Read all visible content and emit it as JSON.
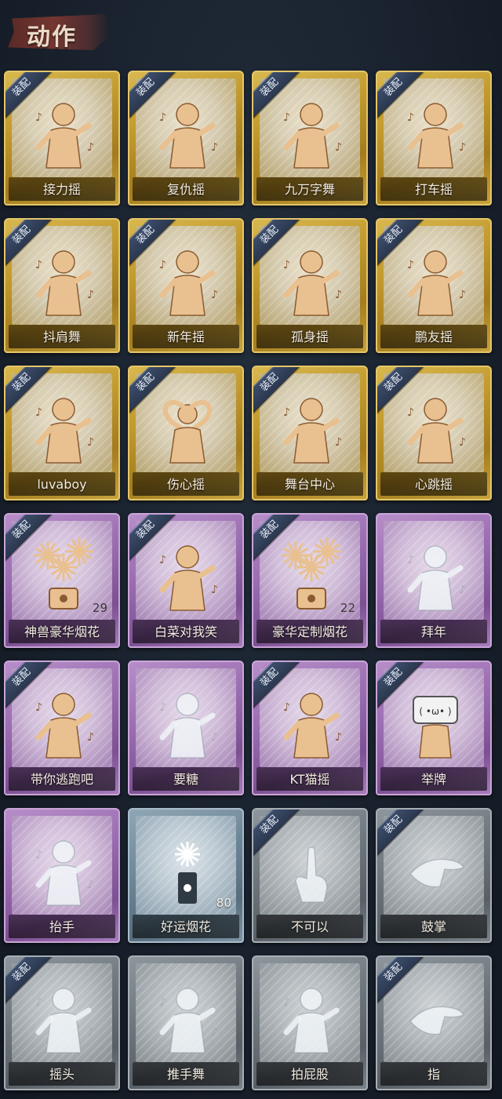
{
  "header": {
    "title": "动作"
  },
  "colors": {
    "gold": "#c7a23c",
    "purple": "#9a6cb0",
    "silver": "#6f777e",
    "blue": "#6e8798",
    "badge": "#2b3850"
  },
  "equip_badge": "装配",
  "cards": [
    {
      "label": "接力摇",
      "tier": "gold",
      "equipped": true,
      "icon": "dancer-icon",
      "count": ""
    },
    {
      "label": "复仇摇",
      "tier": "gold",
      "equipped": true,
      "icon": "dancer-icon",
      "count": ""
    },
    {
      "label": "九万字舞",
      "tier": "gold",
      "equipped": true,
      "icon": "dancer-icon",
      "count": ""
    },
    {
      "label": "打车摇",
      "tier": "gold",
      "equipped": true,
      "icon": "dancer-icon",
      "count": ""
    },
    {
      "label": "抖肩舞",
      "tier": "gold",
      "equipped": true,
      "icon": "dancer-icon",
      "count": ""
    },
    {
      "label": "新年摇",
      "tier": "gold",
      "equipped": true,
      "icon": "dancer-icon",
      "count": ""
    },
    {
      "label": "孤身摇",
      "tier": "gold",
      "equipped": true,
      "icon": "dancer-icon",
      "count": ""
    },
    {
      "label": "鹏友摇",
      "tier": "gold",
      "equipped": true,
      "icon": "dancer-icon",
      "count": ""
    },
    {
      "label": "luvaboy",
      "tier": "gold",
      "equipped": true,
      "icon": "dancer-icon",
      "count": ""
    },
    {
      "label": "伤心摇",
      "tier": "gold",
      "equipped": true,
      "icon": "heart-hands-icon",
      "count": ""
    },
    {
      "label": "舞台中心",
      "tier": "gold",
      "equipped": true,
      "icon": "dancer-icon",
      "count": ""
    },
    {
      "label": "心跳摇",
      "tier": "gold",
      "equipped": true,
      "icon": "dancer-icon",
      "count": ""
    },
    {
      "label": "神兽豪华烟花",
      "tier": "purple",
      "equipped": true,
      "icon": "fireworks-icon",
      "count": "29"
    },
    {
      "label": "白菜对我笑",
      "tier": "purple",
      "equipped": true,
      "icon": "dancer-icon",
      "count": ""
    },
    {
      "label": "豪华定制烟花",
      "tier": "purple",
      "equipped": true,
      "icon": "fireworks-icon",
      "count": "22"
    },
    {
      "label": "拜年",
      "tier": "purple",
      "equipped": false,
      "icon": "bow-figure-icon",
      "count": ""
    },
    {
      "label": "带你逃跑吧",
      "tier": "purple",
      "equipped": true,
      "icon": "dancer-icon",
      "count": ""
    },
    {
      "label": "要糖",
      "tier": "purple",
      "equipped": false,
      "icon": "figure-icon",
      "count": ""
    },
    {
      "label": "KT猫摇",
      "tier": "purple",
      "equipped": true,
      "icon": "dancer-icon",
      "count": ""
    },
    {
      "label": "举牌",
      "tier": "purple",
      "equipped": true,
      "icon": "sign-figure-icon",
      "count": ""
    },
    {
      "label": "抬手",
      "tier": "purple",
      "equipped": false,
      "icon": "figure-icon",
      "count": ""
    },
    {
      "label": "好运烟花",
      "tier": "blue",
      "equipped": false,
      "icon": "firework-tube-icon",
      "count": "80"
    },
    {
      "label": "不可以",
      "tier": "silver",
      "equipped": true,
      "icon": "finger-icon",
      "count": ""
    },
    {
      "label": "鼓掌",
      "tier": "silver",
      "equipped": true,
      "icon": "clap-icon",
      "count": ""
    },
    {
      "label": "摇头",
      "tier": "silver",
      "equipped": true,
      "icon": "figure-icon",
      "count": ""
    },
    {
      "label": "推手舞",
      "tier": "silver",
      "equipped": false,
      "icon": "figure-icon",
      "count": ""
    },
    {
      "label": "拍屁股",
      "tier": "silver",
      "equipped": false,
      "icon": "figure-icon",
      "count": ""
    },
    {
      "label": "指",
      "tier": "silver",
      "equipped": true,
      "icon": "point-hand-icon",
      "count": ""
    }
  ]
}
